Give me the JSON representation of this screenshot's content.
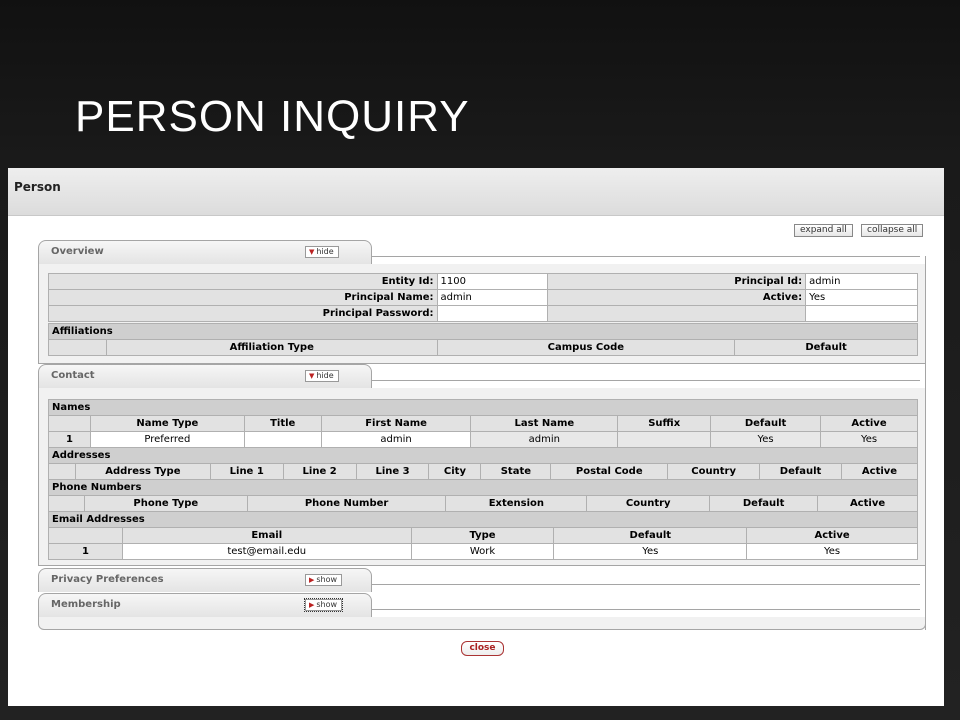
{
  "slide": {
    "title": "PERSON INQUIRY"
  },
  "page": {
    "title": "Person",
    "expand_all": "expand all",
    "collapse_all": "collapse all",
    "close": "close"
  },
  "overview": {
    "tab_label": "Overview",
    "toggle": "hide",
    "entity_id_label": "Entity Id:",
    "entity_id": "1100",
    "principal_id_label": "Principal Id:",
    "principal_id": "admin",
    "principal_name_label": "Principal Name:",
    "principal_name": "admin",
    "active_label": "Active:",
    "active": "Yes",
    "principal_password_label": "Principal Password:",
    "principal_password": "",
    "affiliations": {
      "title": "Affiliations",
      "columns": [
        "Affiliation Type",
        "Campus Code",
        "Default"
      ]
    }
  },
  "contact": {
    "tab_label": "Contact",
    "toggle": "hide",
    "names": {
      "title": "Names",
      "columns": [
        "Name Type",
        "Title",
        "First Name",
        "Last Name",
        "Suffix",
        "Default",
        "Active"
      ],
      "rows": [
        {
          "num": "1",
          "name_type": "Preferred",
          "title": "",
          "first_name": "admin",
          "last_name": "admin",
          "suffix": "",
          "default": "Yes",
          "active": "Yes"
        }
      ]
    },
    "addresses": {
      "title": "Addresses",
      "columns": [
        "Address Type",
        "Line 1",
        "Line 2",
        "Line 3",
        "City",
        "State",
        "Postal Code",
        "Country",
        "Default",
        "Active"
      ]
    },
    "phones": {
      "title": "Phone Numbers",
      "columns": [
        "Phone Type",
        "Phone Number",
        "Extension",
        "Country",
        "Default",
        "Active"
      ]
    },
    "emails": {
      "title": "Email Addresses",
      "columns": [
        "Email",
        "Type",
        "Default",
        "Active"
      ],
      "rows": [
        {
          "num": "1",
          "email": "test@email.edu",
          "type": "Work",
          "default": "Yes",
          "active": "Yes"
        }
      ]
    }
  },
  "privacy": {
    "tab_label": "Privacy Preferences",
    "toggle": "show"
  },
  "membership": {
    "tab_label": "Membership",
    "toggle": "show"
  }
}
